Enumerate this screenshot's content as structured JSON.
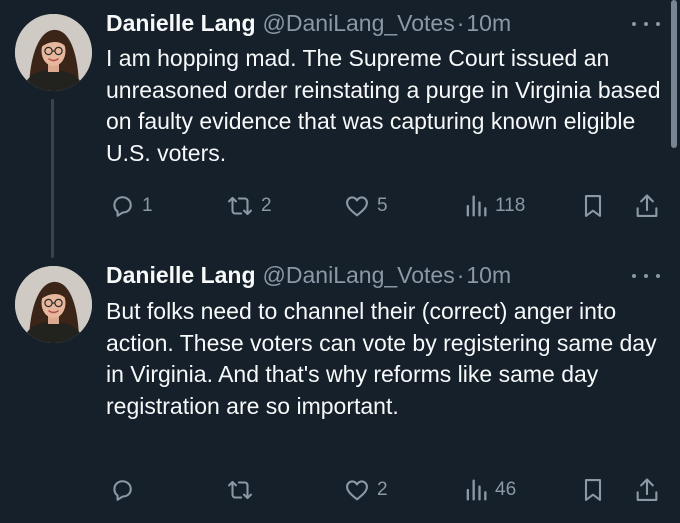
{
  "tweets": [
    {
      "author": {
        "display_name": "Danielle Lang",
        "handle": "@DaniLang_Votes",
        "avatar": "profile-photo"
      },
      "separator": "·",
      "timestamp": "10m",
      "text": "I am hopping mad. The Supreme Court issued an unreasoned order reinstating a purge in Virginia based on faulty evidence that was capturing known eligible U.S. voters.",
      "metrics": {
        "replies": "1",
        "retweets": "2",
        "likes": "5",
        "views": "118"
      }
    },
    {
      "author": {
        "display_name": "Danielle Lang",
        "handle": "@DaniLang_Votes",
        "avatar": "profile-photo"
      },
      "separator": "·",
      "timestamp": "10m",
      "text": "But folks need to channel their (correct) anger into action. These voters can vote by registering same day in Virginia. And that's why reforms like same day registration are so important.",
      "metrics": {
        "replies": "",
        "retweets": "",
        "likes": "2",
        "views": "46"
      }
    }
  ],
  "icons": {
    "reply": "reply-icon",
    "retweet": "retweet-icon",
    "like": "heart-icon",
    "views": "views-icon",
    "bookmark": "bookmark-icon",
    "share": "share-icon",
    "more": "more-options-icon"
  },
  "colors": {
    "background": "#15202b",
    "text_primary": "#f7f9f9",
    "text_secondary": "#8b98a5",
    "thread_line": "#38444d"
  }
}
